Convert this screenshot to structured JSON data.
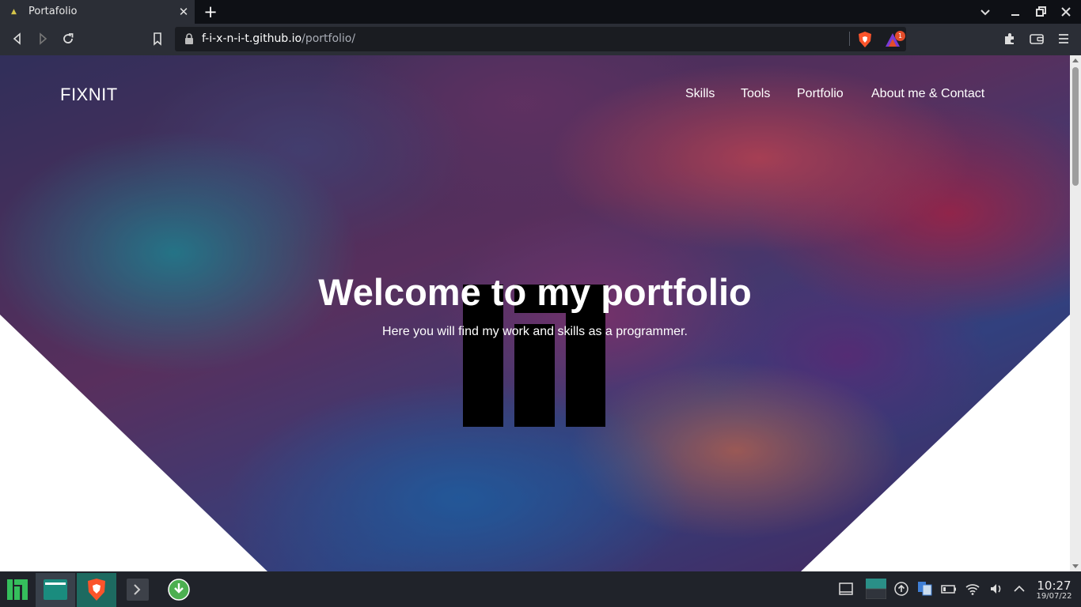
{
  "browser": {
    "tab_title": "Portafolio",
    "url_domain": "f-i-x-n-i-t.github.io",
    "url_path": "/portfolio/",
    "rewards_count": "1"
  },
  "site": {
    "brand": "FIXNIT",
    "nav": [
      "Skills",
      "Tools",
      "Portfolio",
      "About me & Contact"
    ],
    "hero_title": "Welcome to my portfolio",
    "hero_subtitle": "Here you will find my work and skills as a programmer."
  },
  "taskbar": {
    "time": "10:27",
    "date": "19/07/22"
  },
  "colors": {
    "accent_brave": "#fb542b",
    "manjaro_green": "#35bf5c",
    "tab_strip": "#0e1015",
    "toolbar": "#2b2e36"
  }
}
